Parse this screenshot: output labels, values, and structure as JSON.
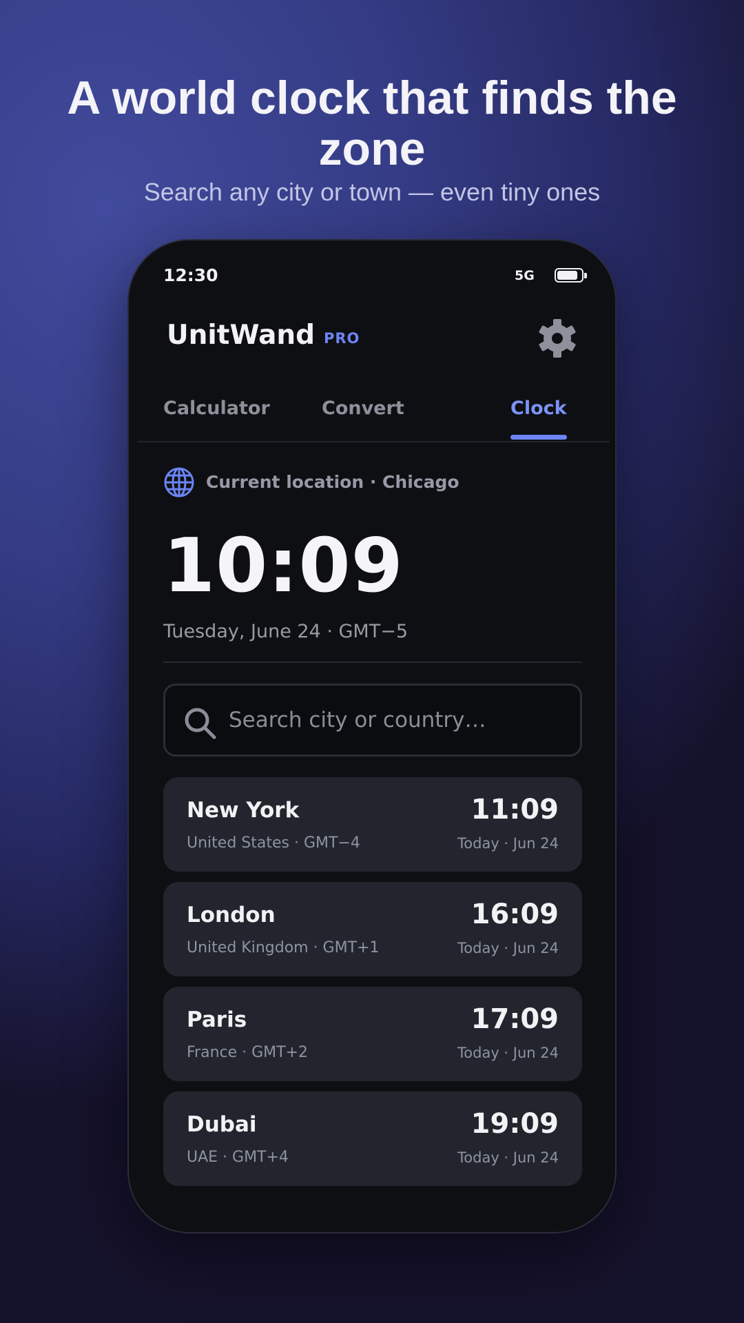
{
  "hero": {
    "title": "A world clock that finds the zone",
    "subtitle": "Search any city or town — even tiny ones"
  },
  "status_bar": {
    "time": "12:30",
    "network": "5G",
    "battery_level": 0.85
  },
  "header": {
    "app_name": "UnitWand",
    "badge": "PRO",
    "settings_icon": "gear-icon"
  },
  "tabs": [
    {
      "label": "Calculator",
      "active": false
    },
    {
      "label": "Convert",
      "active": false
    },
    {
      "label": "Clock",
      "active": true
    }
  ],
  "current": {
    "location_label": "Current location · Chicago",
    "location_icon": "globe-icon",
    "time": "10:09",
    "date_line": "Tuesday, June 24 · GMT−5"
  },
  "search": {
    "placeholder": "Search city or country…",
    "value": ""
  },
  "cities": [
    {
      "name": "New York",
      "meta": "United States · GMT−4",
      "time": "11:09",
      "day": "Today · Jun 24"
    },
    {
      "name": "London",
      "meta": "United Kingdom · GMT+1",
      "time": "16:09",
      "day": "Today · Jun 24"
    },
    {
      "name": "Paris",
      "meta": "France · GMT+2",
      "time": "17:09",
      "day": "Today · Jun 24"
    },
    {
      "name": "Dubai",
      "meta": "UAE · GMT+4",
      "time": "19:09",
      "day": "Today · Jun 24"
    }
  ],
  "colors": {
    "accent": "#6c84f4",
    "background": "#0e0f12",
    "card": "#22252e"
  }
}
